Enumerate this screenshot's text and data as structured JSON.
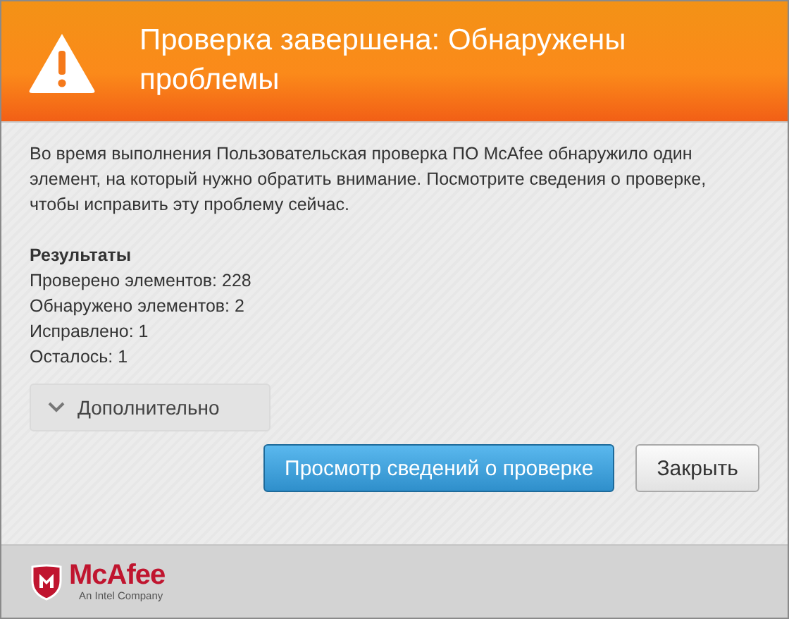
{
  "header": {
    "title": "Проверка завершена: Обнаружены проблемы"
  },
  "message": "Во время выполнения Пользовательская проверка ПО McAfee обнаружило один элемент, на который нужно обратить внимание. Посмотрите сведения о проверке, чтобы исправить эту проблему сейчас.",
  "results": {
    "heading": "Результаты",
    "lines": [
      "Проверено элементов: 228",
      "Обнаружено элементов: 2",
      "Исправлено: 1",
      "Осталось: 1"
    ]
  },
  "more": {
    "label": "Дополнительно",
    "expanded": false
  },
  "buttons": [
    {
      "label": "Просмотр сведений о проверке",
      "kind": "primary"
    },
    {
      "label": "Закрыть",
      "kind": "secondary"
    }
  ],
  "footer": {
    "brand": "McAfee",
    "tagline": "An Intel Company"
  }
}
